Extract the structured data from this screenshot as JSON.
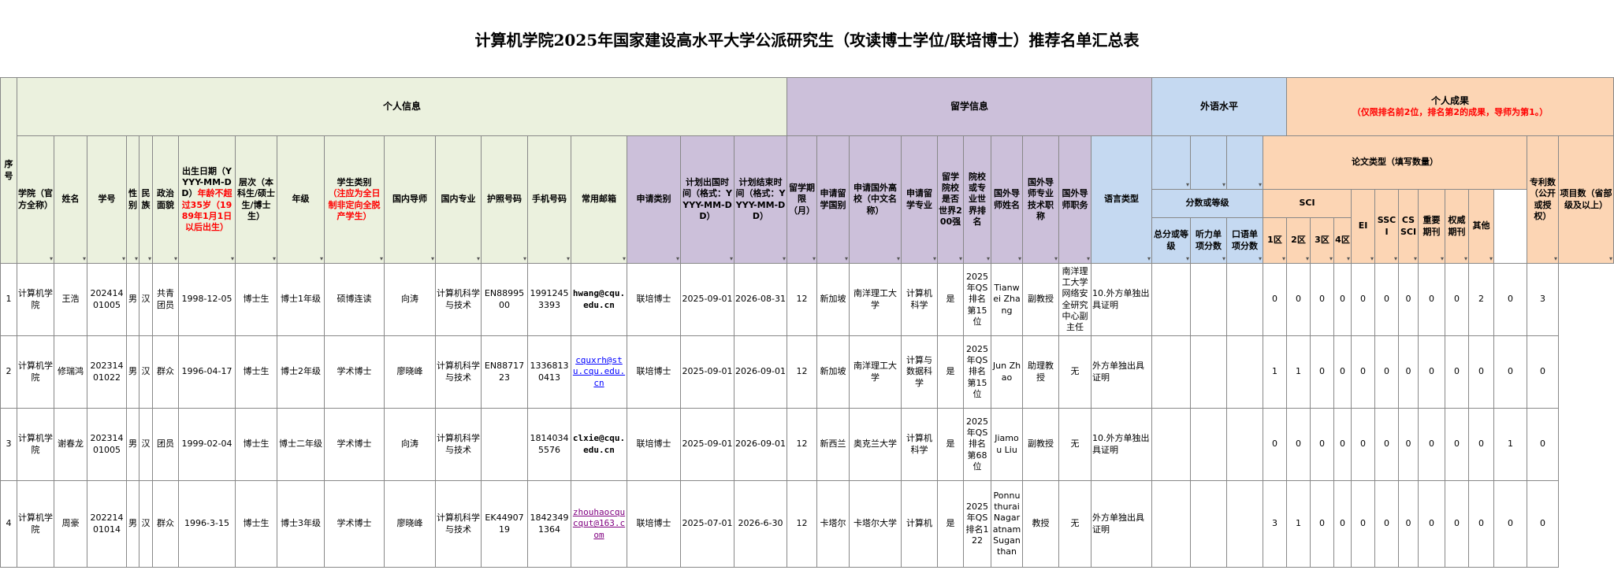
{
  "title": "计算机学院2025年国家建设高水平大学公派研究生（攻读博士学位/联培博士）推荐名单汇总表",
  "groups": {
    "seq": "序号",
    "personal": "个人信息",
    "study": "留学信息",
    "lang": "外语水平",
    "achieve": "个人成果",
    "achieve_note": "（仅限排名前2位，排名第2的成果，导师为第1。）",
    "paper_type": "论文类型（填写数量）",
    "sci": "SCI",
    "score": "分数或等级"
  },
  "headers": {
    "college": "学院（官方全称）",
    "name": "姓名",
    "sid": "学号",
    "gender": "性别",
    "nation": "民族",
    "political": "政治面貌",
    "birth": "出生日期（YYYY-MM-DD）",
    "birth_note": "年龄不超过35岁（1989年1月1日以后出生）",
    "level": "层次（本科生/硕士生/博士生）",
    "grade": "年级",
    "stype": "学生类别",
    "stype_note": "（注应为全日制非定向全脱产学生）",
    "advisor": "国内导师",
    "major": "国内专业",
    "passport": "护照号码",
    "phone": "手机号码",
    "email": "常用邮箱",
    "apply_type": "申请类别",
    "plan_start": "计划出国时间（格式：YYYY-MM-DD）",
    "plan_end": "计划结束时间（格式：YYYY-MM-DD）",
    "duration": "留学期限（月）",
    "country": "申请留学国别",
    "uni": "申请国外高校（中文名称）",
    "fmajor": "申请留学专业",
    "top200": "留学院校是否世界200强",
    "rank": "院校或专业世界排名",
    "fadvisor": "国外导师姓名",
    "ftitle": "国外导师专业技术职称",
    "fpos": "国外导师职务",
    "lang_type": "语言类型",
    "total": "总分或等级",
    "listen": "听力单项分数",
    "oral": "口语单项分数",
    "q1": "1区",
    "q2": "2区",
    "q3": "3区",
    "q4": "4区",
    "ei": "EI",
    "ssci": "SSCI",
    "cssci": "CSSCI",
    "key": "重要期刊",
    "auth": "权威期刊",
    "other": "其他",
    "patent": "专利数（公开或授权）",
    "project": "项目数（省部级及以上）"
  },
  "rows": [
    {
      "seq": "1",
      "college": "计算机学院",
      "name": "王浩",
      "sid": "20241401005",
      "gender": "男",
      "nation": "汉",
      "political": "共青团员",
      "birth": "1998-12-05",
      "level": "博士生",
      "grade": "博士1年级",
      "stype": "硕博连读",
      "advisor": "向涛",
      "major": "计算机科学与技术",
      "passport": "EN8899500",
      "phone": "19912453393",
      "email": "hwang@cqu.edu.cn",
      "apply_type": "联培博士",
      "plan_start": "2025-09-01",
      "plan_end": "2026-08-31",
      "duration": "12",
      "country": "新加坡",
      "uni": "南洋理工大学",
      "fmajor": "计算机科学",
      "top200": "是",
      "rank": "2025年QS排名第15位",
      "fadvisor": "Tianwei Zhang",
      "ftitle": "副教授",
      "fpos": "南洋理工大学网络安全研究中心副主任",
      "lang_type": "10.外方单独出具证明",
      "total": "",
      "listen": "",
      "oral": "",
      "q1": "0",
      "q2": "0",
      "q3": "0",
      "q4": "0",
      "ei": "0",
      "ssci": "0",
      "cssci": "0",
      "key": "0",
      "auth": "0",
      "other": "2",
      "patent": "0",
      "project": "3"
    },
    {
      "seq": "2",
      "college": "计算机学院",
      "name": "修瑞鸿",
      "sid": "20231401022",
      "gender": "男",
      "nation": "汉",
      "political": "群众",
      "birth": "1996-04-17",
      "level": "博士生",
      "grade": "博士2年级",
      "stype": "学术博士",
      "advisor": "廖晓峰",
      "major": "计算机科学与技术",
      "passport": "EN8871723",
      "phone": "13368130413",
      "email": "cquxrh@stu.cqu.edu.cn",
      "apply_type": "联培博士",
      "plan_start": "2025-09-01",
      "plan_end": "2026-09-01",
      "duration": "12",
      "country": "新加坡",
      "uni": "南洋理工大学",
      "fmajor": "计算与数据科学",
      "top200": "是",
      "rank": "2025年QS排名第15位",
      "fadvisor": "Jun Zhao",
      "ftitle": "助理教授",
      "fpos": "无",
      "lang_type": "外方单独出具证明",
      "total": "",
      "listen": "",
      "oral": "",
      "q1": "1",
      "q2": "1",
      "q3": "0",
      "q4": "0",
      "ei": "0",
      "ssci": "0",
      "cssci": "0",
      "key": "0",
      "auth": "0",
      "other": "0",
      "patent": "0",
      "project": "0"
    },
    {
      "seq": "3",
      "college": "计算机学院",
      "name": "谢春龙",
      "sid": "20231401005",
      "gender": "男",
      "nation": "汉",
      "political": "团员",
      "birth": "1999-02-04",
      "level": "博士生",
      "grade": "博士二年级",
      "stype": "学术博士",
      "advisor": "向涛",
      "major": "计算机科学与技术",
      "passport": "",
      "phone": "18140345576",
      "email": "clxie@cqu.edu.cn",
      "apply_type": "联培博士",
      "plan_start": "2025-09-01",
      "plan_end": "2026-09-01",
      "duration": "12",
      "country": "新西兰",
      "uni": "奥克兰大学",
      "fmajor": "计算机科学",
      "top200": "是",
      "rank": "2025年QS排名第68位",
      "fadvisor": "Jiamou Liu",
      "ftitle": "副教授",
      "fpos": "无",
      "lang_type": "10.外方单独出具证明",
      "total": "",
      "listen": "",
      "oral": "",
      "q1": "0",
      "q2": "0",
      "q3": "0",
      "q4": "0",
      "ei": "0",
      "ssci": "0",
      "cssci": "0",
      "key": "0",
      "auth": "0",
      "other": "0",
      "patent": "1",
      "project": "0"
    },
    {
      "seq": "4",
      "college": "计算机学院",
      "name": "周豪",
      "sid": "20221401014",
      "gender": "男",
      "nation": "汉",
      "political": "群众",
      "birth": "1996-3-15",
      "level": "博士生",
      "grade": "博士3年级",
      "stype": "学术博士",
      "advisor": "廖晓峰",
      "major": "计算机科学与技术",
      "passport": "EK4490719",
      "phone": "18423491364",
      "email": "zhouhaocqucqut@163.com",
      "apply_type": "联培博士",
      "plan_start": "2025-07-01",
      "plan_end": "2026-6-30",
      "duration": "12",
      "country": "卡塔尔",
      "uni": "卡塔尔大学",
      "fmajor": "计算机",
      "top200": "是",
      "rank": "2025年QS排名122",
      "fadvisor": "Ponnuthurai Nagaratnam Suganthan",
      "ftitle": "教授",
      "fpos": "无",
      "lang_type": "外方单独出具证明",
      "total": "",
      "listen": "",
      "oral": "",
      "q1": "3",
      "q2": "1",
      "q3": "0",
      "q4": "0",
      "ei": "0",
      "ssci": "0",
      "cssci": "0",
      "key": "0",
      "auth": "0",
      "other": "0",
      "patent": "0",
      "project": "0"
    }
  ],
  "colors": {
    "personal": "#ebf1de",
    "study": "#ccc0da",
    "lang": "#c5d9f1",
    "achieve": "#fcd5b4",
    "red": "#ff0000"
  }
}
